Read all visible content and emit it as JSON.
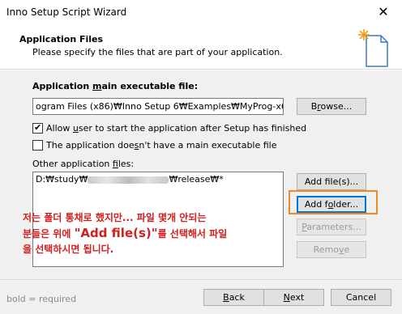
{
  "window": {
    "title": "Inno Setup Script Wizard",
    "close_glyph": "✕"
  },
  "header": {
    "title": "Application Files",
    "subtitle": "Please specify the files that are part of your application."
  },
  "main_exe": {
    "label_pre": "Application ",
    "label_u": "m",
    "label_post": "ain executable file:",
    "value": "ogram Files (x86)₩Inno Setup 6₩Examples₩MyProg-x64.exe",
    "browse_pre": "B",
    "browse_u": "r",
    "browse_post": "owse..."
  },
  "options": {
    "allow_pre": "Allow ",
    "allow_u": "u",
    "allow_post": "ser to start the application after Setup has finished",
    "allow_checked": true,
    "no_main_pre": "The application doe",
    "no_main_u": "s",
    "no_main_post": "n't have a main executable file",
    "no_main_checked": false
  },
  "other_files": {
    "label_pre": "Other application ",
    "label_u": "f",
    "label_post": "iles:",
    "entry_prefix": "D:₩study₩",
    "entry_suffix": "₩release₩*",
    "add_files_pre": "Add f",
    "add_files_u": "i",
    "add_files_post": "le(s)...",
    "add_folder_pre": "Add f",
    "add_folder_u": "o",
    "add_folder_post": "lder...",
    "params_pre": "",
    "params_u": "P",
    "params_post": "arameters...",
    "remove_pre": "Remo",
    "remove_u": "v",
    "remove_post": "e"
  },
  "annotation": {
    "line1": "저는 폴더 통채로 했지만... 파일 몇개 안되는",
    "line2_pre": "분들은 위에 ",
    "line2_big": "\"Add file(s)\"",
    "line2_post": "를 선택해서 파일",
    "line3": "을 선택하시면 됩니다."
  },
  "footer": {
    "hint": "bold = required",
    "back_u": "B",
    "back_post": "ack",
    "next_u": "N",
    "next_post": "ext",
    "cancel": "Cancel"
  },
  "colors": {
    "annotation": "#d21e1e",
    "highlight_box": "#f08a24",
    "accent": "#0078d7"
  }
}
